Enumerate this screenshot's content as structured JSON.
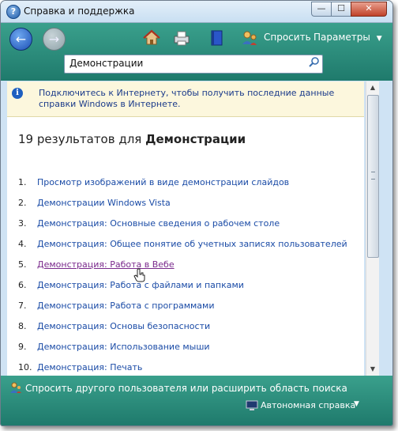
{
  "window": {
    "title": "Справка и поддержка",
    "min_glyph": "—",
    "max_glyph": "☐",
    "close_glyph": "✕"
  },
  "toolbar": {
    "back_glyph": "←",
    "forward_glyph": "→",
    "ask_label": "Спросить",
    "options_label": "Параметры",
    "options_arrow": "▼",
    "icons": [
      "home-icon",
      "printer-icon",
      "browse-help-icon",
      "ask-icon"
    ]
  },
  "search": {
    "value": "Демонстрации"
  },
  "info_bar": {
    "text": "Подключитесь к Интернету, чтобы получить последние данные справки Windows в Интернете."
  },
  "results": {
    "prefix": "19 результатов для",
    "query": "Демонстрации",
    "items": [
      {
        "num": "1.",
        "label": "Просмотр изображений в виде демонстрации слайдов"
      },
      {
        "num": "2.",
        "label": "Демонстрации Windows Vista"
      },
      {
        "num": "3.",
        "label": "Демонстрация: Основные сведения о рабочем столе"
      },
      {
        "num": "4.",
        "label": "Демонстрация: Общее понятие об учетных записях пользователей"
      },
      {
        "num": "5.",
        "label": "Демонстрация: Работа в Вебе"
      },
      {
        "num": "6.",
        "label": "Демонстрация: Работа с файлами и папками"
      },
      {
        "num": "7.",
        "label": "Демонстрация: Работа с программами"
      },
      {
        "num": "8.",
        "label": "Демонстрация: Основы безопасности"
      },
      {
        "num": "9.",
        "label": "Демонстрация: Использование мыши"
      },
      {
        "num": "10.",
        "label": "Демонстрация: Печать"
      }
    ]
  },
  "footer": {
    "ask_other_text": "Спросить другого пользователя или расширить область поиска",
    "offline_label": "Автономная справка",
    "offline_arrow": "▼"
  },
  "colors": {
    "link": "#1a4ba6",
    "visited_link": "#7a2a8c",
    "toolbar_bg": "#2a8d7c",
    "info_bg": "#fcf7dd"
  }
}
